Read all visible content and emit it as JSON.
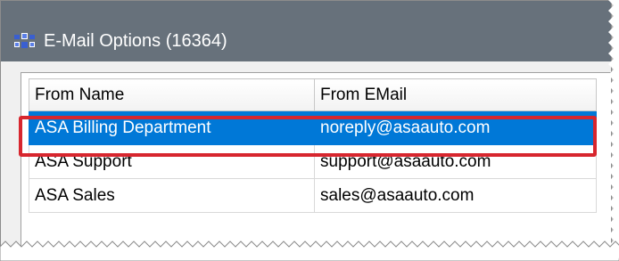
{
  "window": {
    "title": "E-Mail Options (16364)",
    "icon": "app-grid-icon"
  },
  "table": {
    "columns": [
      "From Name",
      "From EMail"
    ],
    "rows": [
      {
        "name": "ASA Billing Department",
        "email": "noreply@asaauto.com",
        "selected": true
      },
      {
        "name": "ASA Support",
        "email": "support@asaauto.com",
        "selected": false
      },
      {
        "name": "ASA Sales",
        "email": "sales@asaauto.com",
        "selected": false
      }
    ]
  },
  "colors": {
    "titlebar": "#67717b",
    "selection": "#0078d7",
    "callout_border": "#d7262e"
  }
}
